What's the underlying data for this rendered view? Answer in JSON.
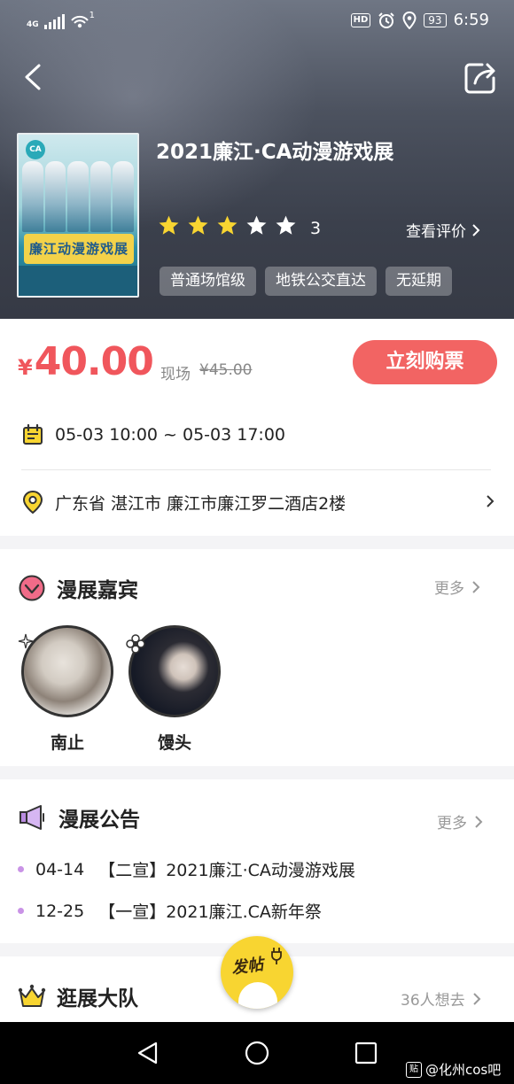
{
  "status_bar": {
    "network": "4G",
    "wifi_badge": "1",
    "hd": "HD",
    "battery": "93",
    "time": "6:59"
  },
  "event": {
    "title": "2021廉江·CA动漫游戏展",
    "poster_logo": "CA",
    "poster_banner": "廉江动漫游戏展",
    "rating_stars": 3,
    "rating_count": "3",
    "view_reviews": "查看评价",
    "tags": [
      "普通场馆级",
      "地铁公交直达",
      "无延期"
    ]
  },
  "ticket": {
    "currency": "¥",
    "price": "40.00",
    "sale_type": "现场",
    "original_price": "¥45.00",
    "buy_label": "立刻购票",
    "time_range": "05-03 10:00 ~ 05-03 17:00",
    "address": "广东省 湛江市 廉江市廉江罗二酒店2楼"
  },
  "guests": {
    "title": "漫展嘉宾",
    "more": "更多",
    "items": [
      {
        "name": "南止"
      },
      {
        "name": "馒头"
      }
    ]
  },
  "notices": {
    "title": "漫展公告",
    "more": "更多",
    "items": [
      {
        "date": "04-14",
        "text": "【二宣】2021廉江·CA动漫游戏展"
      },
      {
        "date": "12-25",
        "text": "【一宣】2021廉江.CA新年祭"
      }
    ]
  },
  "team": {
    "title": "逛展大队",
    "count": "36人想去"
  },
  "fab": {
    "label": "发帖"
  },
  "watermark": {
    "icon": "贴",
    "text": "@化州cos吧"
  },
  "colors": {
    "accent": "#f26463",
    "price": "#f0565c",
    "star": "#f8d531",
    "dot": "#c993e6"
  }
}
